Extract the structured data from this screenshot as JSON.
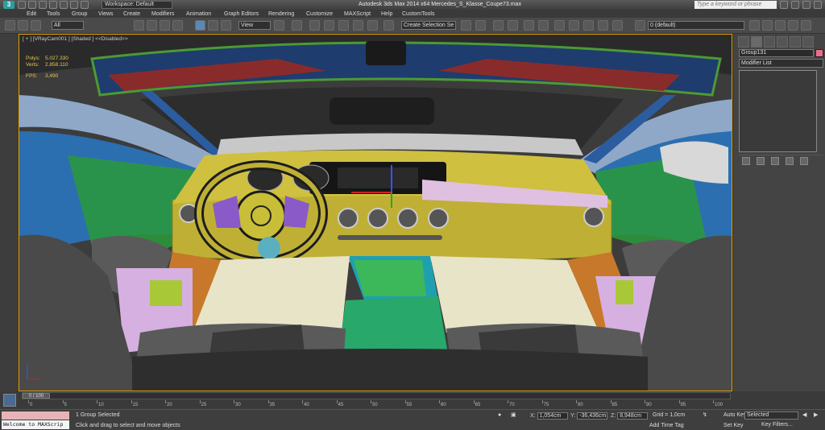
{
  "app": {
    "title": "Autodesk 3ds Max  2014 x64      Mercedes_S_Klasse_Coupe73.max",
    "logo": "3ds-max-logo",
    "workspace": "Workspace: Default",
    "search_placeholder": "Type a keyword or phrase"
  },
  "menu": [
    "Edit",
    "Tools",
    "Group",
    "Views",
    "Create",
    "Modifiers",
    "Animation",
    "Graph Editors",
    "Rendering",
    "Customize",
    "MAXScript",
    "Help",
    "CustomTools"
  ],
  "toolbar": {
    "filter": "All",
    "view": "View",
    "selection_set": "Create Selection Se",
    "layer": "0 (default)"
  },
  "viewport": {
    "label": "[ + ] [VRayCam001 ] [Shaded ] <<Disabled>>",
    "stats": [
      {
        "key": "Polys:",
        "value": "5.027.330"
      },
      {
        "key": "Verts:",
        "value": "2.858.110"
      },
      {
        "key": "FPS:",
        "value": "3,490"
      }
    ]
  },
  "command_panel": {
    "object_name": "Group131",
    "object_color": "#e86f8a",
    "modifier_list": "Modifier List"
  },
  "timeline": {
    "position": "0 / 100",
    "ticks": [
      "0",
      "5",
      "10",
      "15",
      "20",
      "25",
      "30",
      "35",
      "40",
      "45",
      "50",
      "55",
      "60",
      "65",
      "70",
      "75",
      "80",
      "85",
      "90",
      "95",
      "100"
    ]
  },
  "status": {
    "maxscript": "Welcome to MAXScrip",
    "selection": "1 Group Selected",
    "prompt": "Click and drag to select and move objects",
    "x_label": "X:",
    "x": "1,054cm",
    "y_label": "Y:",
    "y": "-36,436cm",
    "z_label": "Z:",
    "z": "8,948cm",
    "grid": "Grid = 1,0cm",
    "auto_key": "Auto Key",
    "set_key": "Set Key",
    "selected": "Selected",
    "key_filters": "Key Filters...",
    "add_time_tag": "Add Time Tag"
  }
}
